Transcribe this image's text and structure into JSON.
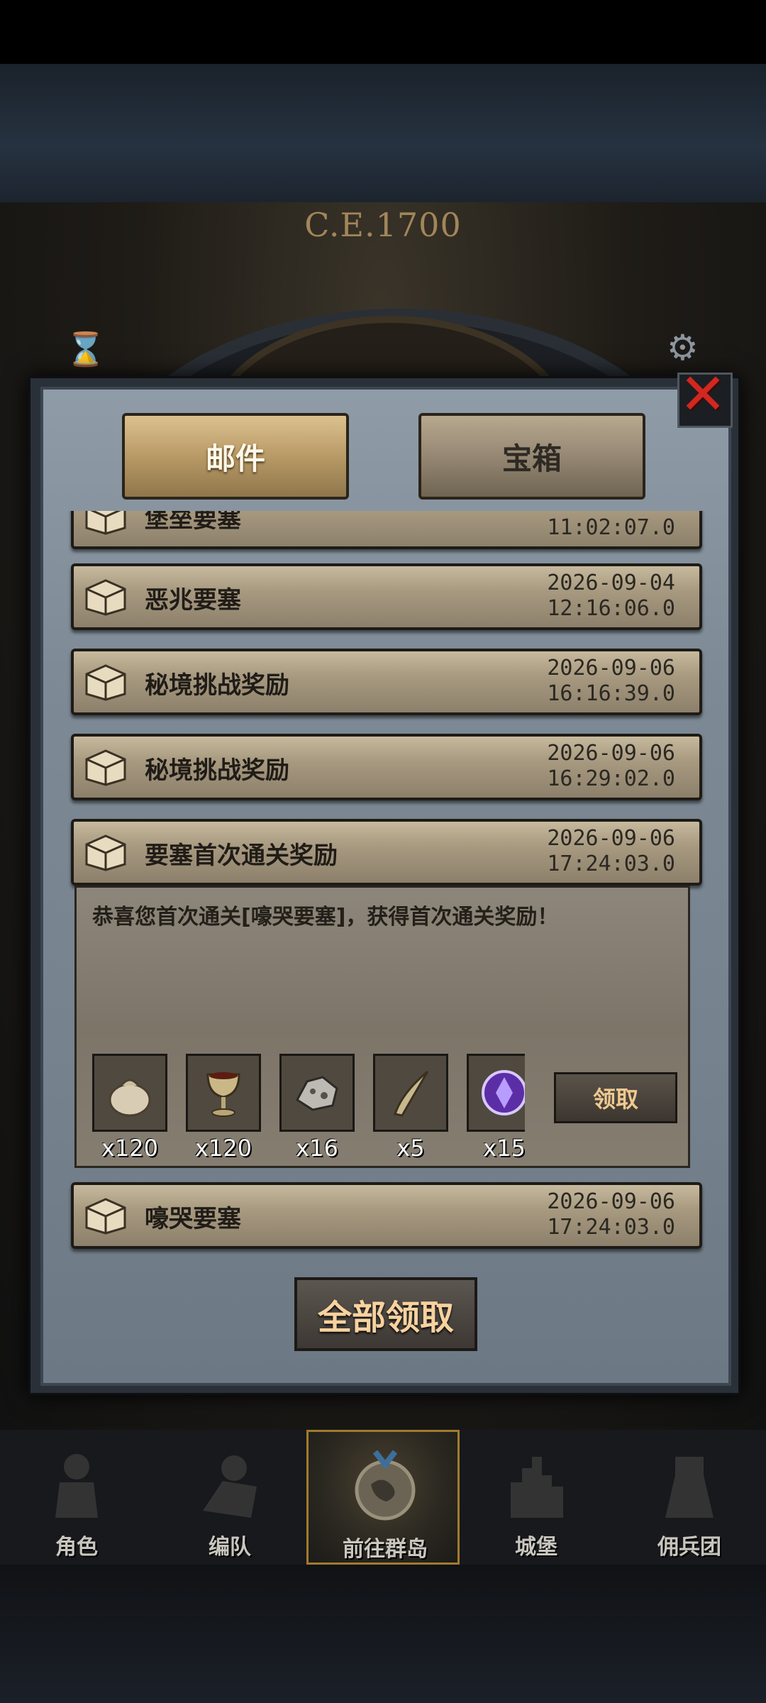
{
  "colors": {
    "close_red": "#d3271f",
    "accent_gold": "#a27a2c",
    "claim_text": "#f7d29f"
  },
  "hud": {
    "era": "C.E.1700"
  },
  "dialog": {
    "tabs": [
      {
        "label": "邮件",
        "active": true
      },
      {
        "label": "宝箱",
        "active": false
      }
    ],
    "mails": [
      {
        "title": "堡垒要塞",
        "date": "",
        "time": "11:02:07.0",
        "icon": "chest-icon"
      },
      {
        "title": "恶兆要塞",
        "date": "2026-09-04",
        "time": "12:16:06.0",
        "icon": "chest-icon"
      },
      {
        "title": "秘境挑战奖励",
        "date": "2026-09-06",
        "time": "16:16:39.0",
        "icon": "chest-icon"
      },
      {
        "title": "秘境挑战奖励",
        "date": "2026-09-06",
        "time": "16:29:02.0",
        "icon": "chest-icon"
      },
      {
        "title": "要塞首次通关奖励",
        "date": "2026-09-06",
        "time": "17:24:03.0",
        "icon": "chest-icon",
        "expanded": true
      },
      {
        "title": "嚎哭要塞",
        "date": "2026-09-06",
        "time": "17:24:03.0",
        "icon": "chest-icon"
      }
    ],
    "detail": {
      "text": "恭喜您首次通关[嚎哭要塞]，获得首次通关奖励！",
      "items": [
        {
          "icon": "sack-icon",
          "qty": "x120"
        },
        {
          "icon": "goblet-icon",
          "qty": "x120"
        },
        {
          "icon": "ore-icon",
          "qty": "x16"
        },
        {
          "icon": "horn-icon",
          "qty": "x5"
        },
        {
          "icon": "purple-crystal-icon",
          "qty": "x15"
        }
      ],
      "claim_label": "领取"
    },
    "claim_all_label": "全部领取"
  },
  "nav": [
    {
      "label": "角色",
      "icon": "knight-icon",
      "active": false
    },
    {
      "label": "编队",
      "icon": "formation-icon",
      "active": false
    },
    {
      "label": "前往群岛",
      "icon": "globe-icon",
      "active": true
    },
    {
      "label": "城堡",
      "icon": "castle-icon",
      "active": false
    },
    {
      "label": "佣兵团",
      "icon": "mercenary-icon",
      "active": false
    }
  ]
}
